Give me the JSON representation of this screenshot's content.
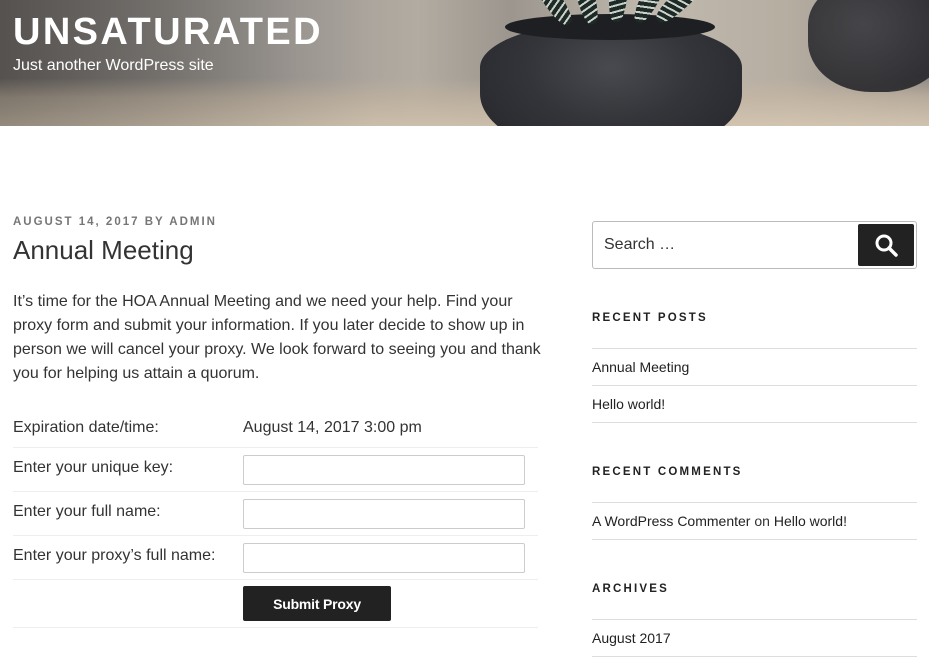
{
  "site": {
    "title": "UNSATURATED",
    "description": "Just another WordPress site"
  },
  "post": {
    "date": "AUGUST 14, 2017",
    "by": "BY",
    "author": "ADMIN",
    "title": "Annual Meeting",
    "body": "It’s time for the HOA Annual Meeting and we need your help. Find your proxy form and submit your information. If you later decide to show up in person we will cancel your proxy. We look forward to seeing you and thank you for helping us attain a quorum."
  },
  "proxy_form": {
    "expiration_label": "Expiration date/time:",
    "expiration_value": "August 14, 2017 3:00 pm",
    "key_label": "Enter your unique key:",
    "key_value": "",
    "name_label": "Enter your full name:",
    "name_value": "",
    "proxy_name_label": "Enter your proxy’s full name:",
    "proxy_name_value": "",
    "submit_label": "Submit Proxy"
  },
  "sidebar": {
    "search": {
      "placeholder": "Search …",
      "icon": "search-icon"
    },
    "recent_posts": {
      "title": "RECENT POSTS",
      "items": [
        "Annual Meeting",
        "Hello world!"
      ]
    },
    "recent_comments": {
      "title": "RECENT COMMENTS",
      "items": [
        {
          "author": "A WordPress Commenter",
          "on": "on",
          "post": "Hello world!"
        }
      ]
    },
    "archives": {
      "title": "ARCHIVES",
      "items": [
        "August 2017"
      ]
    }
  },
  "colors": {
    "accent_dark": "#222222",
    "text": "#333333",
    "meta": "#767676",
    "border": "#dddddd"
  }
}
